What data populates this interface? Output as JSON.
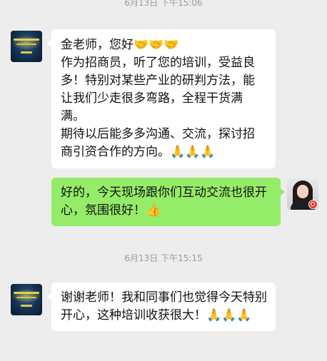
{
  "timestamps": [
    "6月13日 下午15:06",
    "6月13日 下午15:15"
  ],
  "messages": [
    {
      "sender": "contact",
      "avatar": "organization-banner-avatar",
      "lines": [
        "金老师，您好🤝🤝🤝",
        "作为招商员，听了您的培训，受益良多！特别对某些产业的研判方法，能让我们少走很多弯路，全程干货满满。",
        "期待以后能多多沟通、交流，探讨招商引资合作的方向。🙏🙏🙏"
      ]
    },
    {
      "sender": "me",
      "avatar": "woman-portrait-avatar",
      "lines": [
        "好的，今天现场跟你们互动交流也很开心，氛围很好！👍"
      ]
    },
    {
      "sender": "contact",
      "avatar": "organization-banner-avatar",
      "lines": [
        "谢谢老师！我和同事们也觉得今天特别开心，这种培训收获很大！🙏🙏🙏"
      ]
    }
  ],
  "colors": {
    "background": "#ededed",
    "incoming_bubble": "#ffffff",
    "outgoing_bubble": "#95ec69",
    "timestamp_text": "#9b9b9b"
  }
}
